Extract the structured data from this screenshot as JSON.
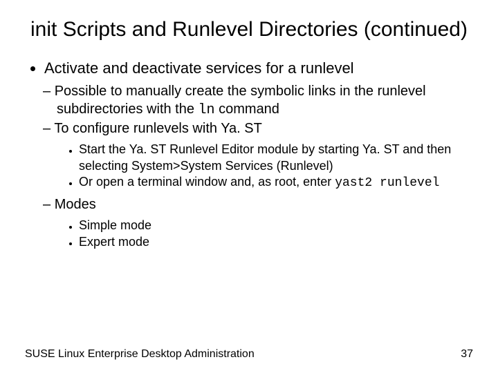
{
  "title": "init Scripts and Runlevel Directories (continued)",
  "l1": {
    "i0": "Activate and deactivate services for a runlevel"
  },
  "l2": {
    "i0a": "Possible to manually create the symbolic links in the runlevel subdirectories with the ",
    "i0cmd": "ln",
    "i0b": " command",
    "i1": "To configure runlevels with Ya. ST",
    "i2": "Modes"
  },
  "l3a": {
    "i0": "Start the Ya. ST Runlevel Editor module by starting Ya. ST and then selecting System>System Services (Runlevel)",
    "i1a": "Or open a terminal window and, as root, enter ",
    "i1cmd": "yast2 runlevel"
  },
  "l3b": {
    "i0": "Simple mode",
    "i1": "Expert mode"
  },
  "footer": {
    "left": "SUSE Linux Enterprise Desktop Administration",
    "right": "37"
  }
}
